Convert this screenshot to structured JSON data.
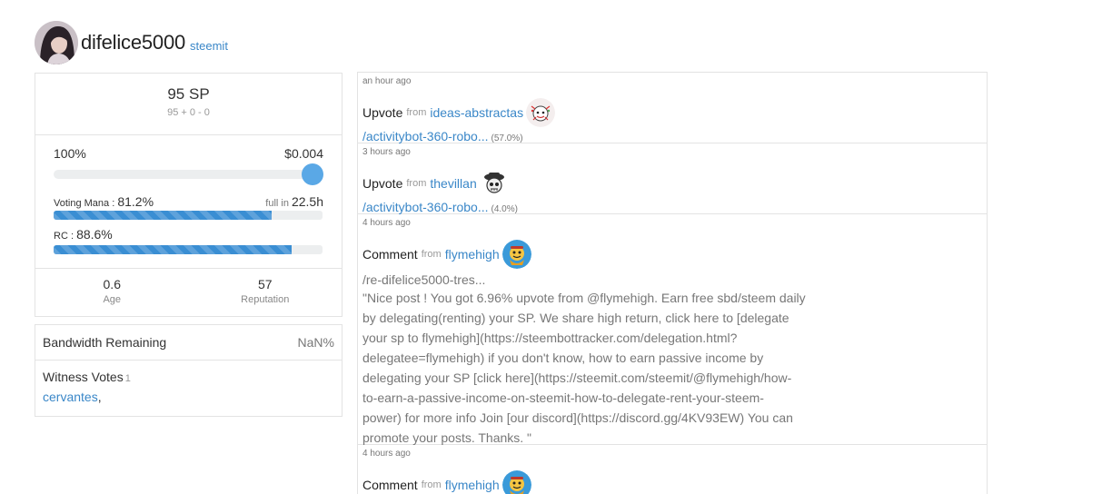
{
  "profile": {
    "username": "difelice5000",
    "source_link": "steemit",
    "avatar_icon": "user-avatar"
  },
  "power": {
    "sp": "95 SP",
    "sp_breakdown": "95 + 0 - 0",
    "vote_weight": "100%",
    "vote_weight_fraction": 1.0,
    "vote_value": "$0.004",
    "voting_mana_label": "Voting Mana :",
    "voting_mana_value": "81.2%",
    "voting_mana_fraction": 0.812,
    "full_in_label": "full in",
    "full_in_value": "22.5h",
    "rc_label": "RC :",
    "rc_value": "88.6%",
    "rc_fraction": 0.886,
    "accent_color": "#3a8ed3"
  },
  "stats": {
    "age_value": "0.6",
    "age_label": "Age",
    "reputation_value": "57",
    "reputation_label": "Reputation"
  },
  "bandwidth": {
    "label": "Bandwidth Remaining",
    "value": "NaN%"
  },
  "witness": {
    "title": "Witness Votes",
    "count": "1",
    "list": "cervantes",
    "separator": ","
  },
  "feed": [
    {
      "time": "an hour ago",
      "action": "Upvote",
      "from": "from",
      "actor": "ideas-abstractas",
      "permlink": "/activitybot-360-robo...",
      "weight": "(57.0%)"
    },
    {
      "time": "3 hours ago",
      "action": "Upvote",
      "from": "from",
      "actor": "thevillan",
      "permlink": "/activitybot-360-robo...",
      "weight": "(4.0%)"
    },
    {
      "time": "4 hours ago",
      "action": "Comment",
      "from": "from",
      "actor": "flymehigh",
      "permlink": "/re-difelice5000-tres...",
      "body_lines": [
        "\"Nice post ! You got 6.96% upvote from @flymehigh. Earn free sbd/steem daily",
        "by delegating(renting) your SP. We share high return, click here to [delegate",
        "your sp to flymehigh](https://steembottracker.com/delegation.html?",
        "delegatee=flymehigh) if you don't know, how to earn passive income by",
        "delegating your SP [click here](https://steemit.com/steemit/@flymehigh/how-",
        "to-earn-a-passive-income-on-steemit-how-to-delegate-rent-your-steem-",
        "power) for more info Join [our discord](https://discord.gg/4KV93EW) You can",
        "promote your posts. Thanks. \""
      ]
    },
    {
      "time": "4 hours ago",
      "action": "Comment",
      "from": "from",
      "actor": "flymehigh"
    }
  ]
}
